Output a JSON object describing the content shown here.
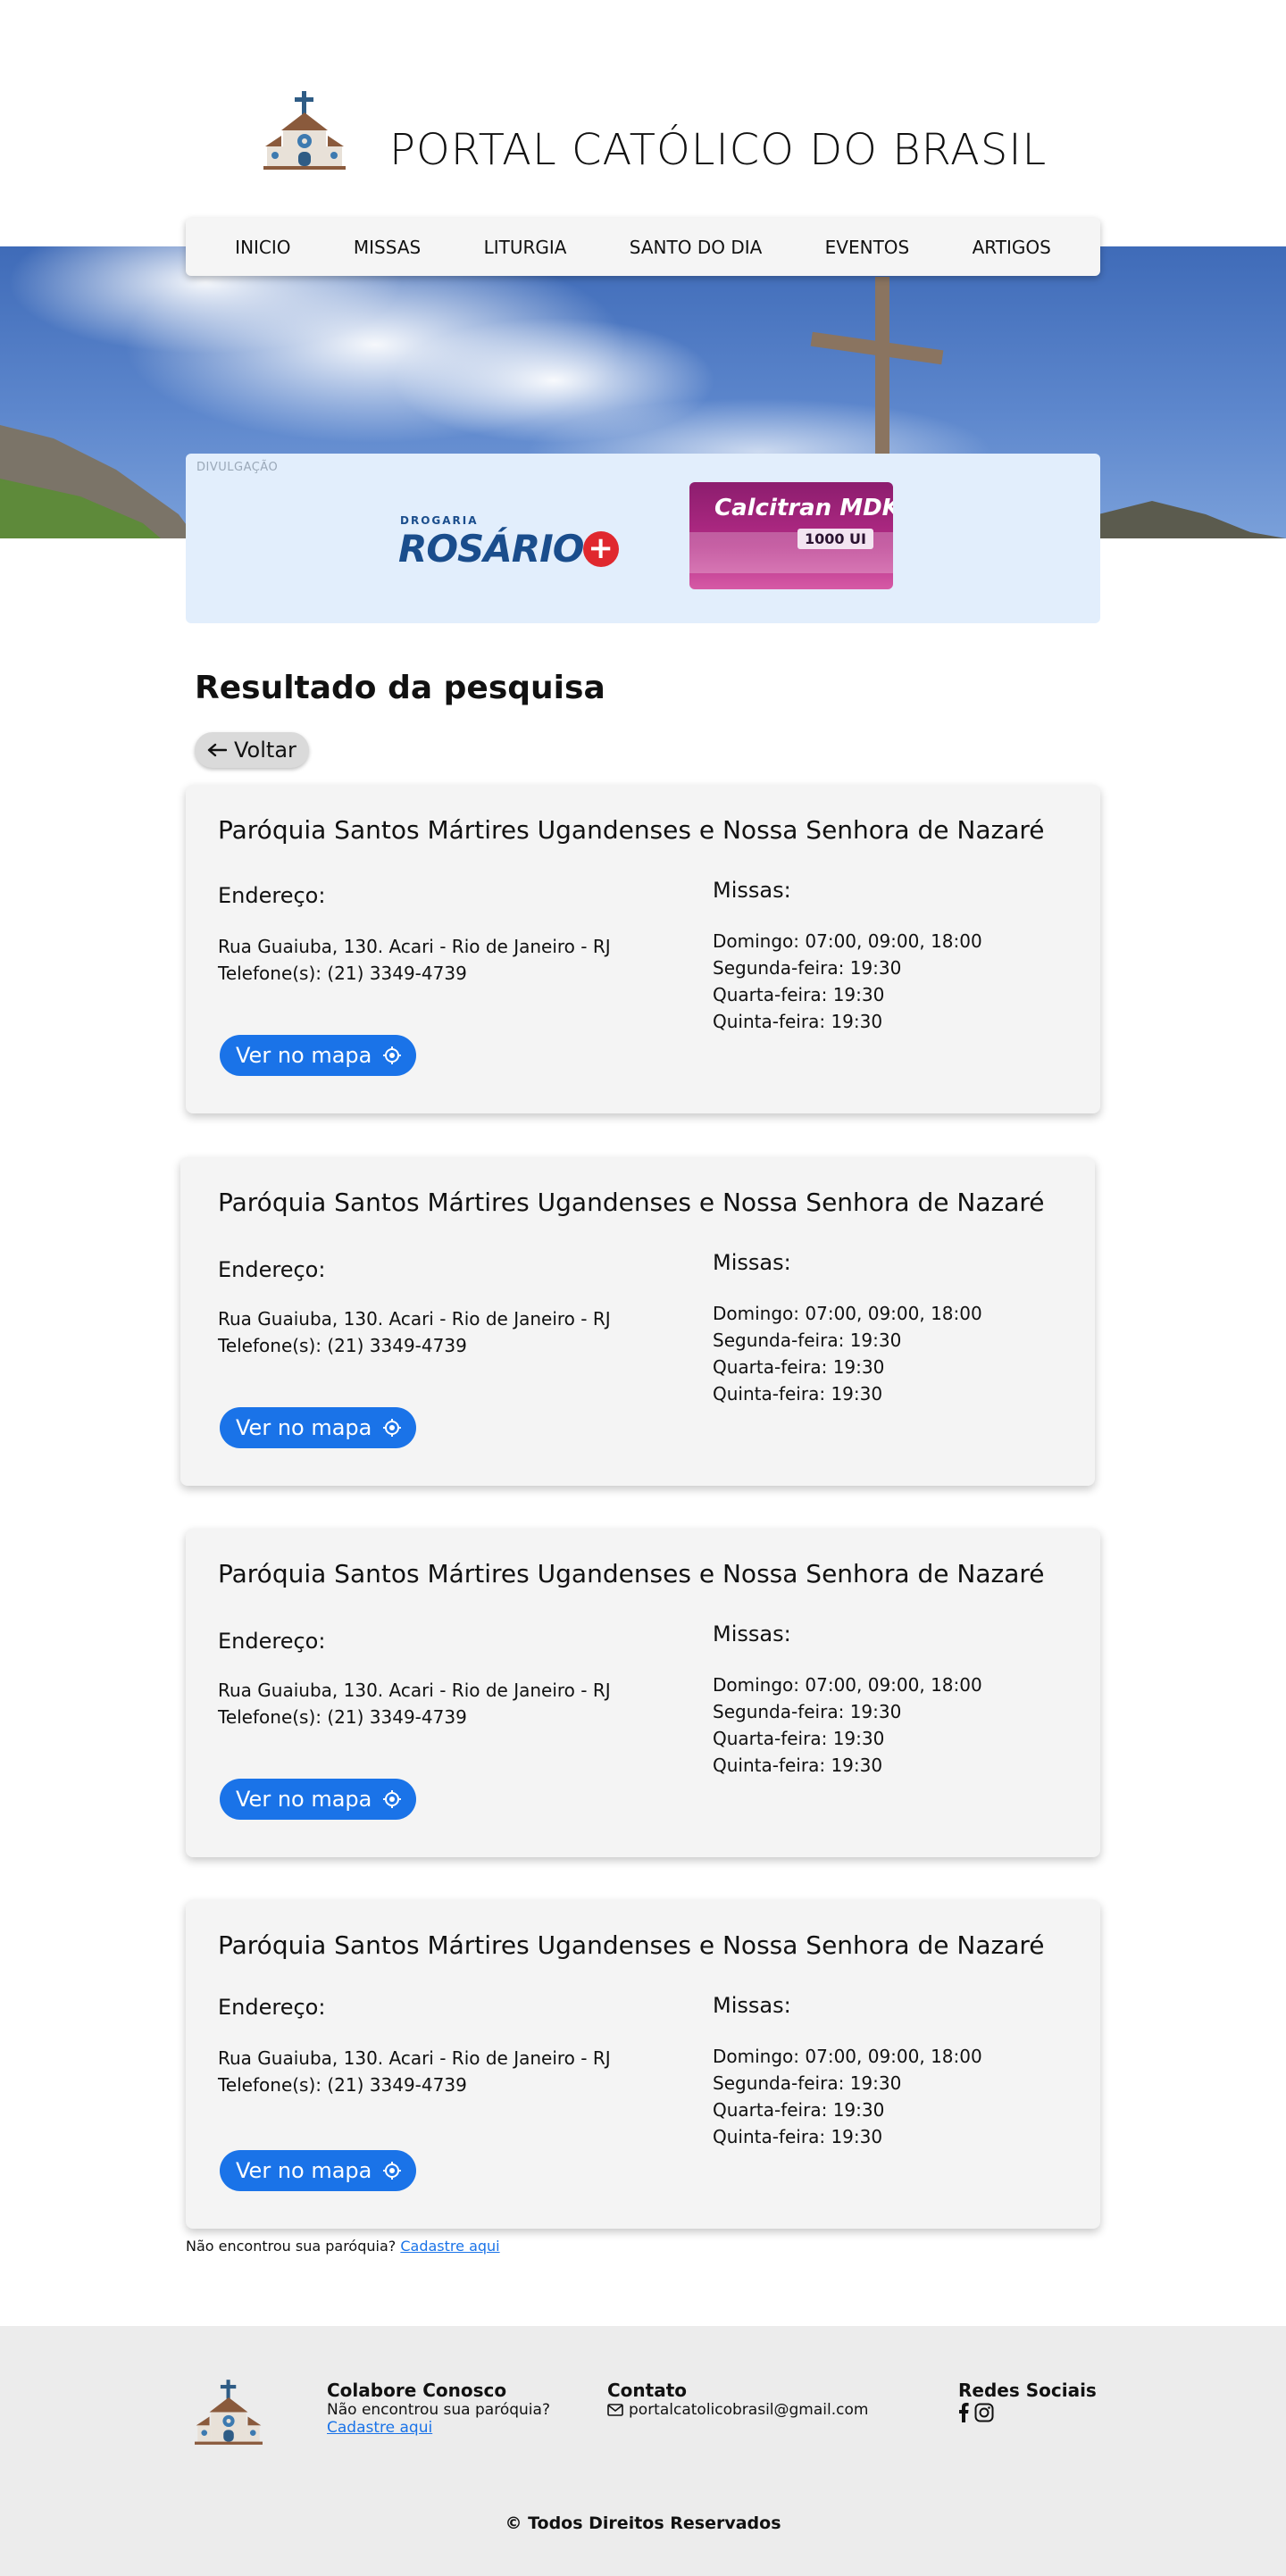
{
  "header": {
    "title": "PORTAL CATÓLICO DO BRASIL",
    "logo_icon": "church-icon"
  },
  "nav": {
    "items": [
      "INICIO",
      "MISSAS",
      "LITURGIA",
      "SANTO DO DIA",
      "EVENTOS",
      "ARTIGOS"
    ]
  },
  "ad": {
    "label": "DIVULGAÇÃO",
    "drogaria_small": "DROGARIA",
    "drogaria_name": "ROSÁRIO",
    "drogaria_plus": "+",
    "product_name": "Calcitran MDK",
    "product_dose": "1000 UI"
  },
  "results": {
    "title": "Resultado da pesquisa",
    "back_label": "Voltar",
    "address_label": "Endereço:",
    "mass_label": "Missas:",
    "map_label": "Ver no mapa",
    "cards": [
      {
        "name": "Paróquia Santos Mártires Ugandenses e Nossa Senhora de Nazaré",
        "address": "Rua Guaiuba, 130. Acari - Rio de Janeiro - RJ",
        "phone": "Telefone(s): (21) 3349-4739",
        "masses": [
          "Domingo: 07:00, 09:00, 18:00",
          "Segunda-feira: 19:30",
          "Quarta-feira: 19:30",
          "Quinta-feira: 19:30"
        ]
      },
      {
        "name": "Paróquia Santos Mártires Ugandenses e Nossa Senhora de Nazaré",
        "address": "Rua Guaiuba, 130. Acari - Rio de Janeiro - RJ",
        "phone": "Telefone(s): (21) 3349-4739",
        "masses": [
          "Domingo: 07:00, 09:00, 18:00",
          "Segunda-feira: 19:30",
          "Quarta-feira: 19:30",
          "Quinta-feira: 19:30"
        ]
      },
      {
        "name": "Paróquia Santos Mártires Ugandenses e Nossa Senhora de Nazaré",
        "address": "Rua Guaiuba, 130. Acari - Rio de Janeiro - RJ",
        "phone": "Telefone(s): (21) 3349-4739",
        "masses": [
          "Domingo: 07:00, 09:00, 18:00",
          "Segunda-feira: 19:30",
          "Quarta-feira: 19:30",
          "Quinta-feira: 19:30"
        ]
      },
      {
        "name": "Paróquia Santos Mártires Ugandenses e Nossa Senhora de Nazaré",
        "address": "Rua Guaiuba, 130. Acari - Rio de Janeiro - RJ",
        "phone": "Telefone(s): (21) 3349-4739",
        "masses": [
          "Domingo: 07:00, 09:00, 18:00",
          "Segunda-feira: 19:30",
          "Quarta-feira: 19:30",
          "Quinta-feira: 19:30"
        ]
      }
    ],
    "not_found_text": "Não encontrou sua paróquia?",
    "not_found_link": "Cadastre aqui"
  },
  "footer": {
    "collab_title": "Colabore Conosco",
    "collab_text": "Não encontrou sua paróquia?",
    "collab_link": "Cadastre aqui",
    "contact_title": "Contato",
    "contact_email": "portalcatolicobrasil@gmail.com",
    "social_title": "Redes Sociais",
    "copyright": "© Todos Direitos Reservados"
  },
  "colors": {
    "accent": "#1a73e8",
    "card_bg": "#f4f4f4",
    "footer_bg": "#ececec",
    "ad_bg": "#e2eefc"
  }
}
